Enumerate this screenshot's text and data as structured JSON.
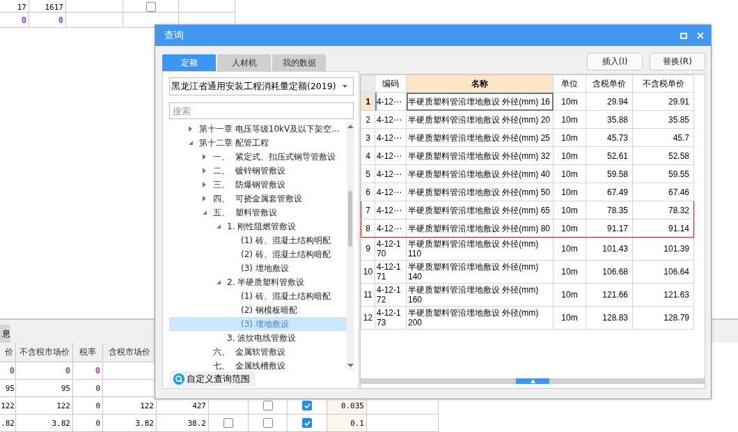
{
  "background": {
    "top_table": {
      "rows": [
        {
          "cells": [
            {
              "kind": "text",
              "text": "17"
            },
            {
              "kind": "text",
              "text": "1617"
            },
            {
              "kind": "blank"
            },
            {
              "kind": "checkbox",
              "checked": false
            },
            {
              "kind": "blank"
            }
          ]
        },
        {
          "color": "#a040c0",
          "cells": [
            {
              "kind": "text",
              "text": "0"
            },
            {
              "kind": "text",
              "text": "0"
            },
            {
              "kind": "blank"
            },
            {
              "kind": "blank"
            },
            {
              "kind": "blank"
            }
          ]
        }
      ]
    },
    "bottom_tab": {
      "label": "息"
    },
    "bottom_table": {
      "columns": [
        "价",
        "不含税市场价",
        "税率",
        "含税市场价"
      ],
      "rows": [
        {
          "color": "#a040c0",
          "cells": [
            {
              "kind": "text",
              "text": "0"
            },
            {
              "kind": "text",
              "text": "0"
            },
            {
              "kind": "text",
              "text": "0"
            },
            {
              "kind": "blank"
            }
          ]
        },
        {
          "cells": [
            {
              "kind": "text",
              "text": "95"
            },
            {
              "kind": "text",
              "text": "95"
            },
            {
              "kind": "text",
              "text": "0"
            },
            {
              "kind": "blank"
            }
          ]
        },
        {
          "cells": [
            {
              "kind": "text",
              "text": "122"
            },
            {
              "kind": "text",
              "text": "122"
            },
            {
              "kind": "text",
              "text": "0"
            },
            {
              "kind": "text",
              "text": "122"
            },
            {
              "kind": "text",
              "text": "427"
            },
            {
              "kind": "blank"
            },
            {
              "kind": "checkbox",
              "checked": false
            },
            {
              "kind": "checkbox",
              "checked": true
            },
            {
              "kind": "text",
              "text": "0.035"
            },
            {
              "kind": "blank"
            }
          ]
        },
        {
          "cells": [
            {
              "kind": "text",
              "text": ".82"
            },
            {
              "kind": "text",
              "text": "3.82"
            },
            {
              "kind": "text",
              "text": "0"
            },
            {
              "kind": "text",
              "text": "3.82"
            },
            {
              "kind": "text",
              "text": "38.2"
            },
            {
              "kind": "checkbox",
              "checked": false
            },
            {
              "kind": "checkbox",
              "checked": false
            },
            {
              "kind": "checkbox",
              "checked": true
            },
            {
              "kind": "text",
              "text": "0.1"
            },
            {
              "kind": "blank"
            }
          ]
        }
      ]
    }
  },
  "dialog": {
    "title": "查询",
    "tabs": [
      {
        "label": "定额",
        "selected": true
      },
      {
        "label": "人材机",
        "selected": false
      },
      {
        "label": "我的数据",
        "selected": false
      }
    ],
    "library": {
      "value": "黑龙江省通用安装工程消耗量定额(2019)"
    },
    "search": {
      "placeholder": "搜索"
    },
    "tree": {
      "items": [
        {
          "label": "第十一章 电压等级10kV及以下架空...",
          "expanded": false,
          "selected": false
        },
        {
          "label": "第十二章 配管工程",
          "expanded": true,
          "selected": false,
          "children": [
            {
              "label": "一、  紧定式、扣压式钢导管敷设",
              "expanded": false,
              "selected": false
            },
            {
              "label": "二、  镀锌钢管敷设",
              "expanded": false,
              "selected": false
            },
            {
              "label": "三、  防爆钢管敷设",
              "expanded": false,
              "selected": false
            },
            {
              "label": "四、  可挠金属套管敷设",
              "expanded": false,
              "selected": false
            },
            {
              "label": "五、  塑料管敷设",
              "expanded": true,
              "selected": false,
              "children": [
                {
                  "label": "1. 刚性阻燃管敷设",
                  "expanded": true,
                  "selected": false,
                  "children": [
                    {
                      "label": "(1) 砖、混凝土结构明配",
                      "selected": false
                    },
                    {
                      "label": "(2) 砖、混凝土结构暗配",
                      "selected": false
                    },
                    {
                      "label": "(3) 埋地敷设",
                      "selected": false
                    }
                  ]
                },
                {
                  "label": "2. 半硬质塑料管敷设",
                  "expanded": true,
                  "selected": false,
                  "children": [
                    {
                      "label": "(1) 砖、混凝土结构暗配",
                      "selected": false
                    },
                    {
                      "label": "(2) 钢模板暗配",
                      "selected": false
                    },
                    {
                      "label": "(3) 埋地敷设",
                      "selected": true
                    }
                  ]
                },
                {
                  "label": "3. 波纹电线管敷设",
                  "selected": false
                }
              ]
            },
            {
              "label": "六、  金属软管敷设",
              "selected": false
            },
            {
              "label": "七、  金属线槽敷设",
              "selected": false
            }
          ]
        }
      ]
    },
    "custom_scope": {
      "label": "自定义查询范围"
    },
    "buttons": [
      "插入(I)",
      "替换(R)"
    ],
    "results": {
      "columns": [
        {
          "label": "编码",
          "selected": false
        },
        {
          "label": "名称",
          "selected": true
        },
        {
          "label": "单位",
          "selected": false
        },
        {
          "label": "含税单价",
          "selected": false
        },
        {
          "label": "不含税单价",
          "selected": false
        }
      ],
      "rows": [
        {
          "no": "1",
          "code": "4-12⋯",
          "name": "半硬质塑料管沿埋地敷设 外径(mm) 16",
          "unit": "10m",
          "tax_price": "29.94",
          "price": "29.91",
          "selected": true,
          "outlined": false
        },
        {
          "no": "2",
          "code": "4-12⋯",
          "name": "半硬质塑料管沿埋地敷设 外径(mm) 20",
          "unit": "10m",
          "tax_price": "35.88",
          "price": "35.85",
          "selected": false,
          "outlined": false
        },
        {
          "no": "3",
          "code": "4-12⋯",
          "name": "半硬质塑料管沿埋地敷设 外径(mm) 25",
          "unit": "10m",
          "tax_price": "45.73",
          "price": "45.7",
          "selected": false,
          "outlined": false
        },
        {
          "no": "4",
          "code": "4-12⋯",
          "name": "半硬质塑料管沿埋地敷设 外径(mm) 32",
          "unit": "10m",
          "tax_price": "52.61",
          "price": "52.58",
          "selected": false,
          "outlined": false
        },
        {
          "no": "5",
          "code": "4-12⋯",
          "name": "半硬质塑料管沿埋地敷设 外径(mm) 40",
          "unit": "10m",
          "tax_price": "59.58",
          "price": "59.55",
          "selected": false,
          "outlined": false
        },
        {
          "no": "6",
          "code": "4-12⋯",
          "name": "半硬质塑料管沿埋地敷设 外径(mm) 50",
          "unit": "10m",
          "tax_price": "67.49",
          "price": "67.46",
          "selected": false,
          "outlined": false
        },
        {
          "no": "7",
          "code": "4-12⋯",
          "name": "半硬质塑料管沿埋地敷设 外径(mm) 65",
          "unit": "10m",
          "tax_price": "78.35",
          "price": "78.32",
          "selected": false,
          "outlined": true
        },
        {
          "no": "8",
          "code": "4-12⋯",
          "name": "半硬质塑料管沿埋地敷设 外径(mm) 80",
          "unit": "10m",
          "tax_price": "91.17",
          "price": "91.14",
          "selected": false,
          "outlined": true
        },
        {
          "no": "9",
          "code": "4-12-170",
          "name": "半硬质塑料管沿埋地敷设 外径(mm) 110",
          "unit": "10m",
          "tax_price": "101.43",
          "price": "101.39",
          "selected": false,
          "outlined": false
        },
        {
          "no": "10",
          "code": "4-12-171",
          "name": "半硬质塑料管沿埋地敷设 外径(mm) 140",
          "unit": "10m",
          "tax_price": "106.68",
          "price": "106.64",
          "selected": false,
          "outlined": false
        },
        {
          "no": "11",
          "code": "4-12-172",
          "name": "半硬质塑料管沿埋地敷设 外径(mm) 160",
          "unit": "10m",
          "tax_price": "121.66",
          "price": "121.63",
          "selected": false,
          "outlined": false
        },
        {
          "no": "12",
          "code": "4-12-173",
          "name": "半硬质塑料管沿埋地敷设 外径(mm) 200",
          "unit": "10m",
          "tax_price": "128.83",
          "price": "128.79",
          "selected": false,
          "outlined": false
        }
      ]
    }
  }
}
